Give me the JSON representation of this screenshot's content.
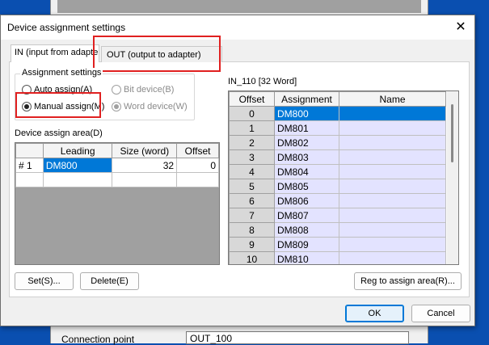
{
  "background": {
    "connection_label": "Connection point",
    "connection_value": "OUT_100"
  },
  "dialog": {
    "title": "Device assignment settings",
    "tabs": [
      {
        "label": "IN (input from adapter)"
      },
      {
        "label": "OUT (output to adapter)"
      }
    ],
    "assignment_settings": {
      "label": "Assignment settings",
      "auto_assign": "Auto assign(A)",
      "manual_assign": "Manual assign(M)",
      "bit_device": "Bit device(B)",
      "word_device": "Word device(W)"
    },
    "device_area": {
      "label": "Device assign area(D)",
      "headers": [
        "",
        "Leading",
        "Size (word)",
        "Offset"
      ],
      "rows": [
        {
          "no": "# 1",
          "leading": "DM800",
          "size": "32",
          "offset": "0"
        }
      ]
    },
    "in_list": {
      "label": "IN_110 [32 Word]",
      "headers": [
        "Offset",
        "Assignment",
        "Name"
      ],
      "rows": [
        {
          "offset": "0",
          "assignment": "DM800",
          "name": ""
        },
        {
          "offset": "1",
          "assignment": "DM801",
          "name": ""
        },
        {
          "offset": "2",
          "assignment": "DM802",
          "name": ""
        },
        {
          "offset": "3",
          "assignment": "DM803",
          "name": ""
        },
        {
          "offset": "4",
          "assignment": "DM804",
          "name": ""
        },
        {
          "offset": "5",
          "assignment": "DM805",
          "name": ""
        },
        {
          "offset": "6",
          "assignment": "DM806",
          "name": ""
        },
        {
          "offset": "7",
          "assignment": "DM807",
          "name": ""
        },
        {
          "offset": "8",
          "assignment": "DM808",
          "name": ""
        },
        {
          "offset": "9",
          "assignment": "DM809",
          "name": ""
        },
        {
          "offset": "10",
          "assignment": "DM810",
          "name": ""
        }
      ]
    },
    "buttons": {
      "set": "Set(S)...",
      "delete": "Delete(E)",
      "reg": "Reg to assign area(R)...",
      "ok": "OK",
      "cancel": "Cancel"
    },
    "close_glyph": "✕",
    "colors": {
      "selection": "#0078d7",
      "highlight_box": "#e02020",
      "assignment_bg": "#e3e3ff"
    }
  }
}
